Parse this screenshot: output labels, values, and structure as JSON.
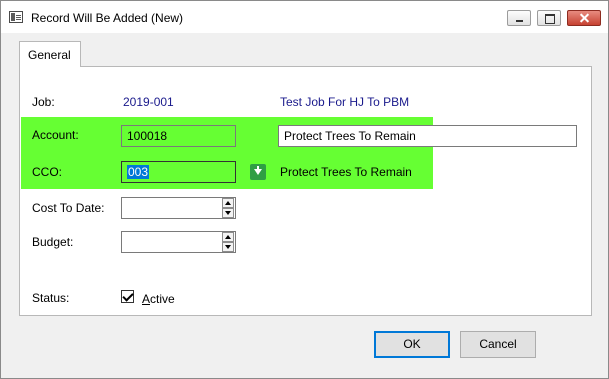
{
  "window": {
    "title": "Record Will Be Added  (New)"
  },
  "tabs": [
    {
      "label": "General"
    }
  ],
  "form": {
    "job": {
      "label": "Job:",
      "value": "2019-001",
      "description": "Test Job For HJ To PBM"
    },
    "account": {
      "label": "Account:",
      "value": "100018",
      "description": "Protect Trees To Remain"
    },
    "cco": {
      "label": "CCO:",
      "value": "003",
      "description": "Protect Trees To Remain"
    },
    "cost_to_date": {
      "label": "Cost To Date:",
      "value": ""
    },
    "budget": {
      "label": "Budget:",
      "value": ""
    },
    "status": {
      "label": "Status:",
      "checkbox_label_underlined": "A",
      "checkbox_label_rest": "ctive",
      "checked": true
    }
  },
  "buttons": {
    "ok": "OK",
    "cancel": "Cancel"
  },
  "colors": {
    "highlight": "#66ff33",
    "selection": "#0078d7",
    "link_text": "#1a1a8c"
  }
}
